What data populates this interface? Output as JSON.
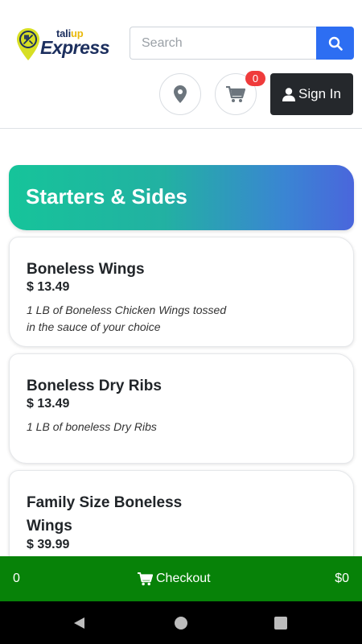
{
  "header": {
    "logo_top_prefix": "tali",
    "logo_top_suffix": "up",
    "logo_main": "Express",
    "search_placeholder": "Search",
    "search_icon": "search-icon",
    "location_icon": "map-marker-icon",
    "cart_icon": "shopping-cart-icon",
    "cart_count": "0",
    "signin_icon": "user-icon",
    "signin_label": "Sign In"
  },
  "category": {
    "title": "Starters & Sides"
  },
  "menu_items": [
    {
      "name": "Boneless Wings",
      "price": "$ 13.49",
      "description": "1 LB of Boneless Chicken Wings tossed in the sauce of your choice"
    },
    {
      "name": "Boneless Dry Ribs",
      "price": "$ 13.49",
      "description": "1 LB of boneless Dry Ribs"
    },
    {
      "name": "Family Size Boneless Wings",
      "price": "$ 39.99",
      "description": ""
    }
  ],
  "checkout": {
    "count": "0",
    "label": "Checkout",
    "icon": "shopping-cart-icon",
    "total": "$0"
  },
  "colors": {
    "search_button": "#2d6ef2",
    "signin_button": "#25282c",
    "cart_badge": "#ef3b3b",
    "checkout_bar": "#078208",
    "banner_gradient_start": "#16c49a",
    "banner_gradient_end": "#4a66dc"
  }
}
